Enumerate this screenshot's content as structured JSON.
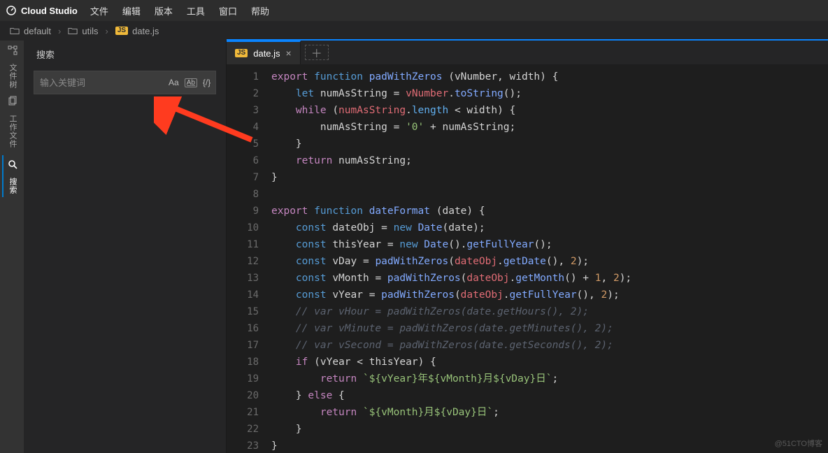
{
  "menubar": {
    "app_name": "Cloud Studio",
    "items": [
      "文件",
      "编辑",
      "版本",
      "工具",
      "窗口",
      "帮助"
    ]
  },
  "breadcrumb": {
    "items": [
      {
        "icon": "folder",
        "label": "default"
      },
      {
        "icon": "folder",
        "label": "utils"
      },
      {
        "icon": "js",
        "label": "date.js"
      }
    ]
  },
  "activitybar": {
    "items": [
      {
        "icon": "tree",
        "label": "文件树"
      },
      {
        "icon": "files",
        "label": "工作文件"
      },
      {
        "icon": "search",
        "label": "搜索",
        "active": true
      }
    ]
  },
  "sidepanel": {
    "title": "搜索",
    "search": {
      "placeholder": "输入关键词",
      "options": {
        "case": "Aa",
        "word": "A̲b̲",
        "regex": "{/}"
      }
    }
  },
  "editor": {
    "tab": {
      "icon": "js",
      "label": "date.js"
    },
    "line_start": 1,
    "line_end": 23,
    "code": [
      [
        [
          "kw",
          "export"
        ],
        [
          "sp",
          " "
        ],
        [
          "kw2",
          "function"
        ],
        [
          "sp",
          " "
        ],
        [
          "fn",
          "padWithZeros"
        ],
        [
          "sp",
          " "
        ],
        [
          "op",
          "("
        ],
        [
          "txt",
          "vNumber"
        ],
        [
          "op",
          ","
        ],
        [
          "sp",
          " "
        ],
        [
          "txt",
          "width"
        ],
        [
          "op",
          ")"
        ],
        [
          "sp",
          " "
        ],
        [
          "op",
          "{"
        ]
      ],
      [
        [
          "sp",
          "    "
        ],
        [
          "kw2",
          "let"
        ],
        [
          "sp",
          " "
        ],
        [
          "txt",
          "numAsString"
        ],
        [
          "sp",
          " "
        ],
        [
          "op",
          "="
        ],
        [
          "sp",
          " "
        ],
        [
          "var2",
          "vNumber"
        ],
        [
          "op",
          "."
        ],
        [
          "call",
          "toString"
        ],
        [
          "op",
          "();"
        ]
      ],
      [
        [
          "sp",
          "    "
        ],
        [
          "kw",
          "while"
        ],
        [
          "sp",
          " "
        ],
        [
          "op",
          "("
        ],
        [
          "var2",
          "numAsString"
        ],
        [
          "op",
          "."
        ],
        [
          "prop",
          "length"
        ],
        [
          "sp",
          " "
        ],
        [
          "op",
          "<"
        ],
        [
          "sp",
          " "
        ],
        [
          "txt",
          "width"
        ],
        [
          "op",
          ")"
        ],
        [
          "sp",
          " "
        ],
        [
          "op",
          "{"
        ]
      ],
      [
        [
          "sp",
          "        "
        ],
        [
          "txt",
          "numAsString"
        ],
        [
          "sp",
          " "
        ],
        [
          "op",
          "="
        ],
        [
          "sp",
          " "
        ],
        [
          "str",
          "'0'"
        ],
        [
          "sp",
          " "
        ],
        [
          "op",
          "+"
        ],
        [
          "sp",
          " "
        ],
        [
          "txt",
          "numAsString"
        ],
        [
          "op",
          ";"
        ]
      ],
      [
        [
          "sp",
          "    "
        ],
        [
          "op",
          "}"
        ]
      ],
      [
        [
          "sp",
          "    "
        ],
        [
          "kw",
          "return"
        ],
        [
          "sp",
          " "
        ],
        [
          "txt",
          "numAsString"
        ],
        [
          "op",
          ";"
        ]
      ],
      [
        [
          "op",
          "}"
        ]
      ],
      [],
      [
        [
          "kw",
          "export"
        ],
        [
          "sp",
          " "
        ],
        [
          "kw2",
          "function"
        ],
        [
          "sp",
          " "
        ],
        [
          "fn",
          "dateFormat"
        ],
        [
          "sp",
          " "
        ],
        [
          "op",
          "("
        ],
        [
          "txt",
          "date"
        ],
        [
          "op",
          ")"
        ],
        [
          "sp",
          " "
        ],
        [
          "op",
          "{"
        ]
      ],
      [
        [
          "sp",
          "    "
        ],
        [
          "kw2",
          "const"
        ],
        [
          "sp",
          " "
        ],
        [
          "txt",
          "dateObj"
        ],
        [
          "sp",
          " "
        ],
        [
          "op",
          "="
        ],
        [
          "sp",
          " "
        ],
        [
          "kw2",
          "new"
        ],
        [
          "sp",
          " "
        ],
        [
          "call",
          "Date"
        ],
        [
          "op",
          "("
        ],
        [
          "txt",
          "date"
        ],
        [
          "op",
          ");"
        ]
      ],
      [
        [
          "sp",
          "    "
        ],
        [
          "kw2",
          "const"
        ],
        [
          "sp",
          " "
        ],
        [
          "txt",
          "thisYear"
        ],
        [
          "sp",
          " "
        ],
        [
          "op",
          "="
        ],
        [
          "sp",
          " "
        ],
        [
          "kw2",
          "new"
        ],
        [
          "sp",
          " "
        ],
        [
          "call",
          "Date"
        ],
        [
          "op",
          "()."
        ],
        [
          "call",
          "getFullYear"
        ],
        [
          "op",
          "();"
        ]
      ],
      [
        [
          "sp",
          "    "
        ],
        [
          "kw2",
          "const"
        ],
        [
          "sp",
          " "
        ],
        [
          "txt",
          "vDay"
        ],
        [
          "sp",
          " "
        ],
        [
          "op",
          "="
        ],
        [
          "sp",
          " "
        ],
        [
          "call",
          "padWithZeros"
        ],
        [
          "op",
          "("
        ],
        [
          "var2",
          "dateObj"
        ],
        [
          "op",
          "."
        ],
        [
          "call",
          "getDate"
        ],
        [
          "op",
          "(),"
        ],
        [
          "sp",
          " "
        ],
        [
          "num",
          "2"
        ],
        [
          "op",
          ");"
        ]
      ],
      [
        [
          "sp",
          "    "
        ],
        [
          "kw2",
          "const"
        ],
        [
          "sp",
          " "
        ],
        [
          "txt",
          "vMonth"
        ],
        [
          "sp",
          " "
        ],
        [
          "op",
          "="
        ],
        [
          "sp",
          " "
        ],
        [
          "call",
          "padWithZeros"
        ],
        [
          "op",
          "("
        ],
        [
          "var2",
          "dateObj"
        ],
        [
          "op",
          "."
        ],
        [
          "call",
          "getMonth"
        ],
        [
          "op",
          "()"
        ],
        [
          "sp",
          " "
        ],
        [
          "op",
          "+"
        ],
        [
          "sp",
          " "
        ],
        [
          "num",
          "1"
        ],
        [
          "op",
          ","
        ],
        [
          "sp",
          " "
        ],
        [
          "num",
          "2"
        ],
        [
          "op",
          ");"
        ]
      ],
      [
        [
          "sp",
          "    "
        ],
        [
          "kw2",
          "const"
        ],
        [
          "sp",
          " "
        ],
        [
          "txt",
          "vYear"
        ],
        [
          "sp",
          " "
        ],
        [
          "op",
          "="
        ],
        [
          "sp",
          " "
        ],
        [
          "call",
          "padWithZeros"
        ],
        [
          "op",
          "("
        ],
        [
          "var2",
          "dateObj"
        ],
        [
          "op",
          "."
        ],
        [
          "call",
          "getFullYear"
        ],
        [
          "op",
          "(),"
        ],
        [
          "sp",
          " "
        ],
        [
          "num",
          "2"
        ],
        [
          "op",
          ");"
        ]
      ],
      [
        [
          "sp",
          "    "
        ],
        [
          "com",
          "// var vHour = padWithZeros(date.getHours(), 2);"
        ]
      ],
      [
        [
          "sp",
          "    "
        ],
        [
          "com",
          "// var vMinute = padWithZeros(date.getMinutes(), 2);"
        ]
      ],
      [
        [
          "sp",
          "    "
        ],
        [
          "com",
          "// var vSecond = padWithZeros(date.getSeconds(), 2);"
        ]
      ],
      [
        [
          "sp",
          "    "
        ],
        [
          "kw",
          "if"
        ],
        [
          "sp",
          " "
        ],
        [
          "op",
          "("
        ],
        [
          "txt",
          "vYear"
        ],
        [
          "sp",
          " "
        ],
        [
          "op",
          "<"
        ],
        [
          "sp",
          " "
        ],
        [
          "txt",
          "thisYear"
        ],
        [
          "op",
          ")"
        ],
        [
          "sp",
          " "
        ],
        [
          "op",
          "{"
        ]
      ],
      [
        [
          "sp",
          "        "
        ],
        [
          "kw",
          "return"
        ],
        [
          "sp",
          " "
        ],
        [
          "str",
          "`${vYear}年${vMonth}月${vDay}日`"
        ],
        [
          "op",
          ";"
        ]
      ],
      [
        [
          "sp",
          "    "
        ],
        [
          "op",
          "}"
        ],
        [
          "sp",
          " "
        ],
        [
          "kw",
          "else"
        ],
        [
          "sp",
          " "
        ],
        [
          "op",
          "{"
        ]
      ],
      [
        [
          "sp",
          "        "
        ],
        [
          "kw",
          "return"
        ],
        [
          "sp",
          " "
        ],
        [
          "str",
          "`${vMonth}月${vDay}日`"
        ],
        [
          "op",
          ";"
        ]
      ],
      [
        [
          "sp",
          "    "
        ],
        [
          "op",
          "}"
        ]
      ],
      [
        [
          "op",
          "}"
        ]
      ]
    ]
  },
  "watermark": "@51CTO博客"
}
